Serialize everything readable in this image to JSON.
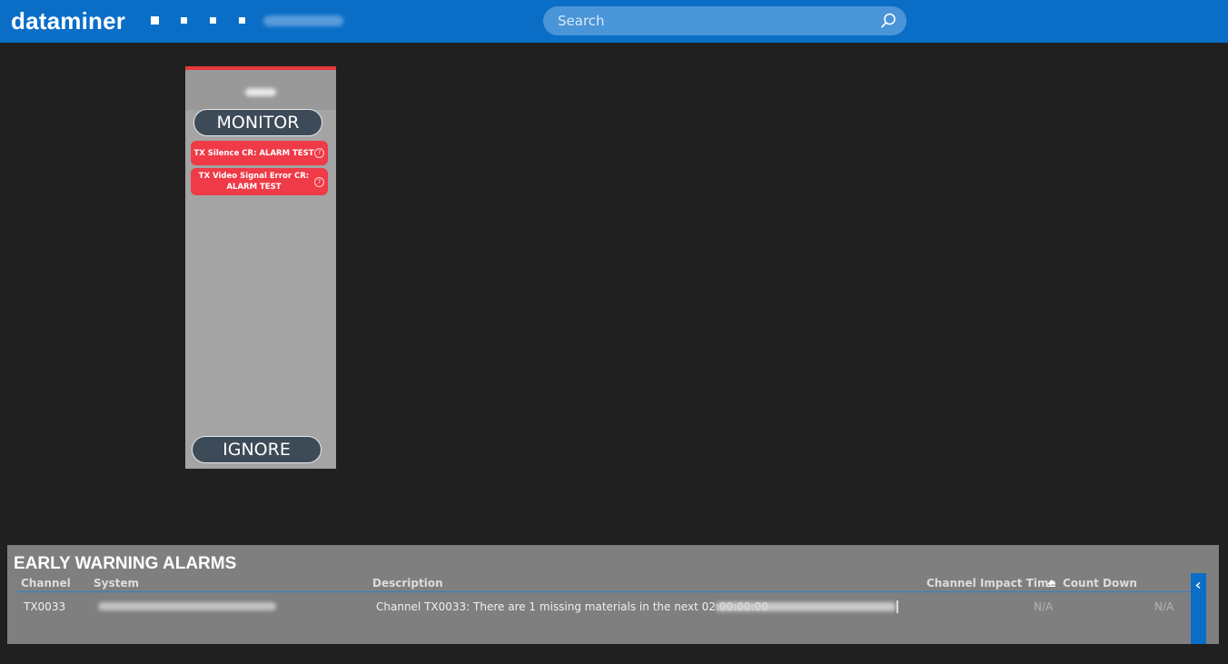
{
  "header": {
    "logo": "dataminer",
    "search_placeholder": "Search"
  },
  "alarm_card": {
    "monitor_label": "MONITOR",
    "ignore_label": "IGNORE",
    "alarms": [
      {
        "text": "TX Silence CR:  ALARM TEST"
      },
      {
        "text": "TX Video Signal Error CR: ALARM TEST"
      }
    ],
    "help_glyph": "?"
  },
  "early_warning": {
    "title": "EARLY WARNING ALARMS",
    "columns": [
      "Channel",
      "System",
      "Description",
      "Channel Impact Time",
      "Count Down"
    ],
    "rows": [
      {
        "channel": "TX0033",
        "description": "Channel TX0033: There are 1 missing materials in the next 02:00:00:00",
        "impact_time": "N/A",
        "count_down": "N/A"
      }
    ]
  },
  "colors": {
    "brand_blue": "#0a6ec7",
    "alarm_red": "#ef3a47",
    "background": "#202020"
  }
}
